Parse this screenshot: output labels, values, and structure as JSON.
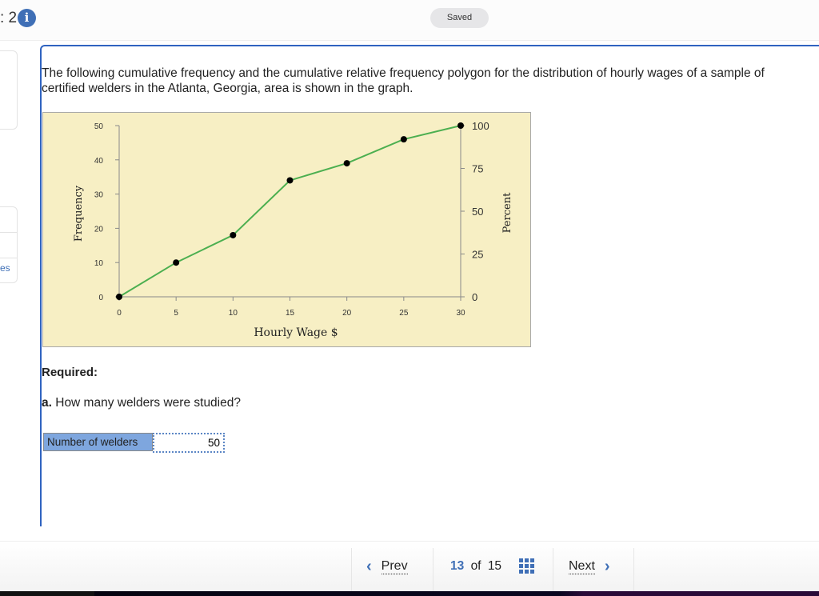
{
  "header": {
    "question_number": ": 2",
    "info_icon": "info-icon",
    "saved_label": "Saved"
  },
  "sidebar": {
    "partial_link": "es"
  },
  "question": {
    "prompt_line1": "The following cumulative frequency and the cumulative relative frequency polygon for the distribution of hourly wages of a sample of",
    "prompt_line2": "certified welders in the Atlanta, Georgia, area is shown in the graph.",
    "required_label": "Required:",
    "part_a_prefix": "a.",
    "part_a_text": " How many welders were studied?",
    "answer_label": "Number of welders",
    "answer_value": "50"
  },
  "chart_data": {
    "type": "line",
    "title": "",
    "xlabel": "Hourly Wage $",
    "ylabel": "Frequency",
    "y2label": "Percent",
    "x": [
      0,
      5,
      10,
      15,
      20,
      25,
      30
    ],
    "series": [
      {
        "name": "Cumulative frequency",
        "values": [
          0,
          10,
          18,
          34,
          39,
          46,
          50
        ]
      }
    ],
    "xlim": [
      0,
      30
    ],
    "ylim": [
      0,
      50
    ],
    "y2lim": [
      0,
      100
    ],
    "xticks": [
      "0",
      "5",
      "10",
      "15",
      "20",
      "25",
      "30"
    ],
    "yticks": [
      "0",
      "10",
      "20",
      "30",
      "40",
      "50"
    ],
    "y2ticks": [
      "0",
      "25",
      "50",
      "75",
      "100"
    ],
    "grid": false,
    "line_color": "#4caf50",
    "marker_color": "#000000",
    "background": "#f7efc4"
  },
  "footer": {
    "prev_label": "Prev",
    "current_page": "13",
    "of_label": "of",
    "total_pages": "15",
    "next_label": "Next",
    "accent": "#3f6fb6"
  }
}
